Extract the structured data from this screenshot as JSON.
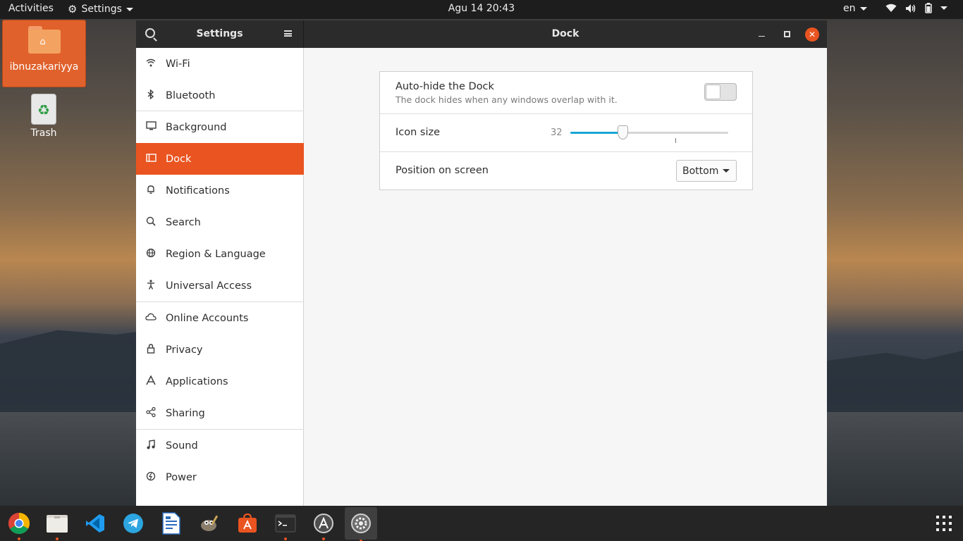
{
  "topbar": {
    "activities": "Activities",
    "app_menu": "Settings",
    "clock": "Agu 14  20:43",
    "language": "en"
  },
  "desktop": {
    "home_label": "ibnuzakariyya",
    "trash_label": "Trash"
  },
  "window": {
    "sidebar_title": "Settings",
    "panel_title": "Dock"
  },
  "sidebar": {
    "items": [
      {
        "label": "Wi-Fi",
        "icon": "wifi-icon"
      },
      {
        "label": "Bluetooth",
        "icon": "bluetooth-icon"
      },
      {
        "label": "Background",
        "icon": "monitor-icon"
      },
      {
        "label": "Dock",
        "icon": "dock-icon"
      },
      {
        "label": "Notifications",
        "icon": "bell-icon"
      },
      {
        "label": "Search",
        "icon": "search-icon"
      },
      {
        "label": "Region & Language",
        "icon": "globe-icon"
      },
      {
        "label": "Universal Access",
        "icon": "accessibility-icon"
      },
      {
        "label": "Online Accounts",
        "icon": "cloud-icon"
      },
      {
        "label": "Privacy",
        "icon": "lock-icon"
      },
      {
        "label": "Applications",
        "icon": "applications-icon"
      },
      {
        "label": "Sharing",
        "icon": "share-icon"
      },
      {
        "label": "Sound",
        "icon": "music-note-icon"
      },
      {
        "label": "Power",
        "icon": "power-icon"
      }
    ],
    "active_item": "Dock"
  },
  "dock_settings": {
    "autohide_title": "Auto-hide the Dock",
    "autohide_subtitle": "The dock hides when any windows overlap with it.",
    "autohide_enabled": false,
    "icon_size_label": "Icon size",
    "icon_size_value": "32",
    "icon_size_fraction": 0.33,
    "position_label": "Position on screen",
    "position_value": "Bottom"
  },
  "colors": {
    "accent": "#e95420",
    "slider": "#19a7d4"
  },
  "dock_apps": [
    {
      "name": "chrome-icon",
      "running": true
    },
    {
      "name": "files-icon",
      "running": true
    },
    {
      "name": "vscode-icon",
      "running": false
    },
    {
      "name": "telegram-icon",
      "running": false
    },
    {
      "name": "writer-icon",
      "running": false
    },
    {
      "name": "gimp-icon",
      "running": false
    },
    {
      "name": "software-center-icon",
      "running": false
    },
    {
      "name": "terminal-icon",
      "running": true
    },
    {
      "name": "software-updater-icon",
      "running": true
    },
    {
      "name": "settings-icon",
      "running": true
    }
  ]
}
